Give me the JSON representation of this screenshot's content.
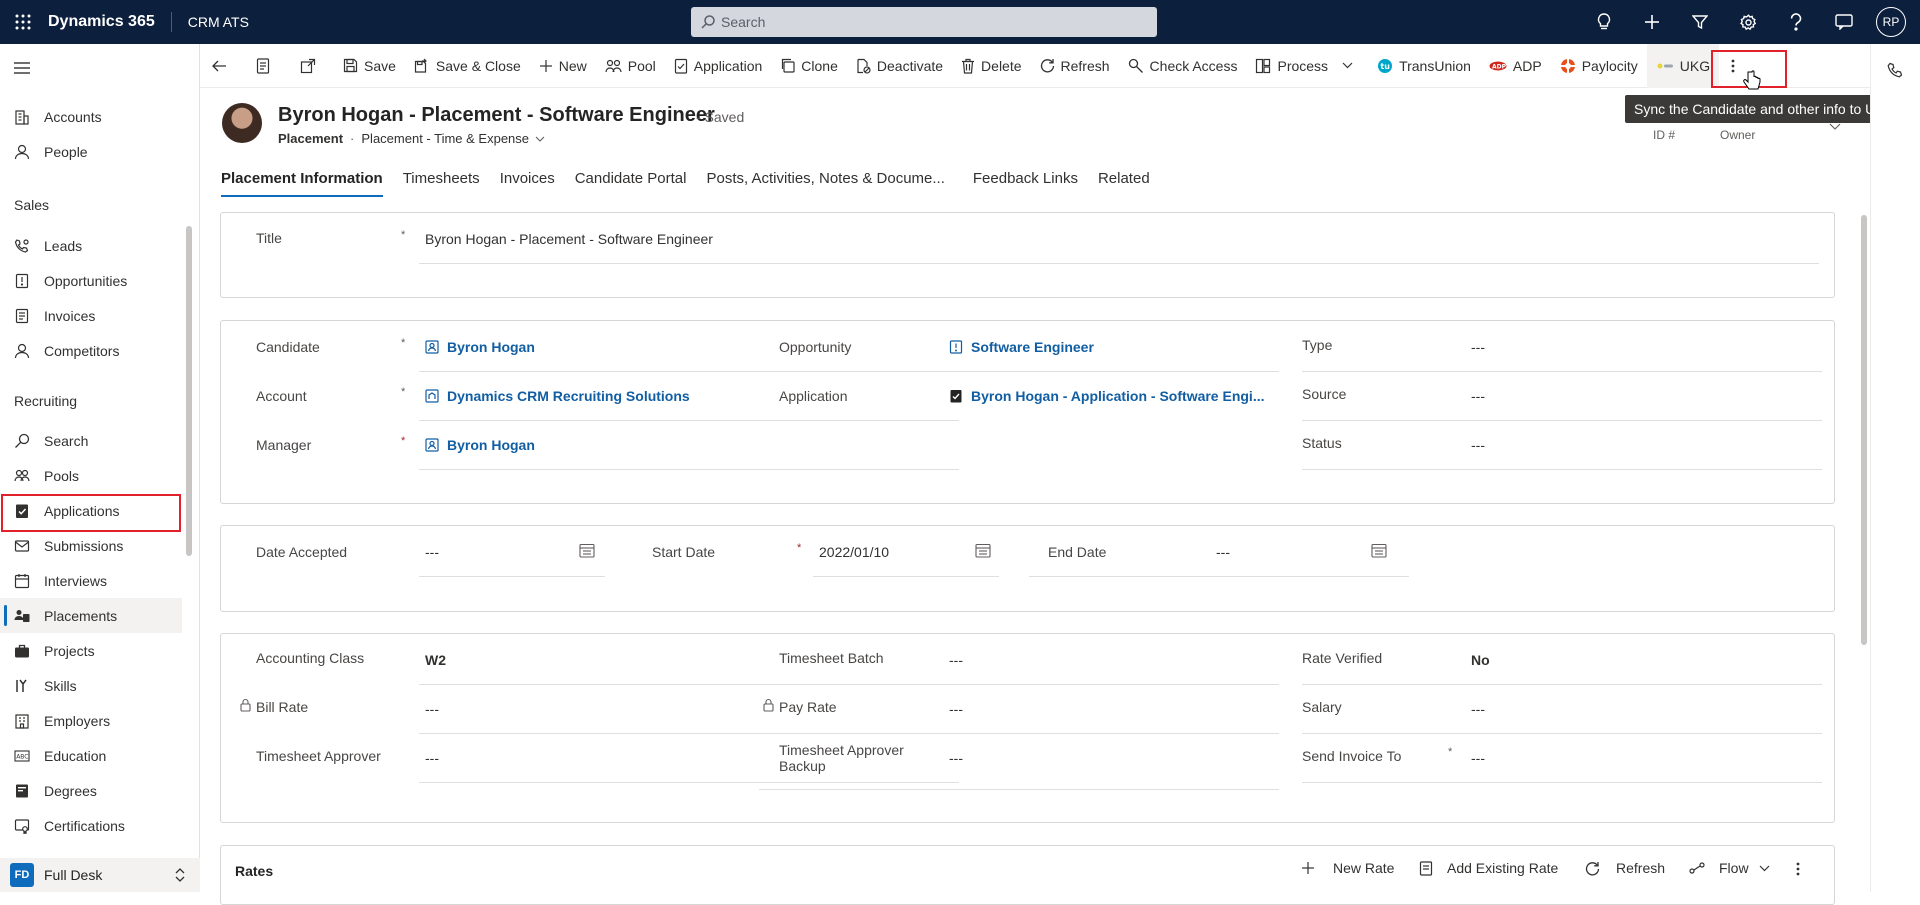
{
  "topbar": {
    "brand": "Dynamics 365",
    "app_name": "CRM ATS",
    "search_placeholder": "Search",
    "user_initials": "RP"
  },
  "sidebar": {
    "items_top": [
      {
        "label": "Accounts",
        "icon": "building-icon"
      },
      {
        "label": "People",
        "icon": "person-icon"
      }
    ],
    "section_sales": "Sales",
    "items_sales": [
      {
        "label": "Leads",
        "icon": "phone-person-icon"
      },
      {
        "label": "Opportunities",
        "icon": "document-alert-icon"
      },
      {
        "label": "Invoices",
        "icon": "invoice-icon"
      },
      {
        "label": "Competitors",
        "icon": "person-icon"
      }
    ],
    "section_recruiting": "Recruiting",
    "items_recruiting": [
      {
        "label": "Search",
        "icon": "search-icon"
      },
      {
        "label": "Pools",
        "icon": "people-group-icon"
      },
      {
        "label": "Applications",
        "icon": "clipboard-check-icon"
      },
      {
        "label": "Submissions",
        "icon": "submission-icon"
      },
      {
        "label": "Interviews",
        "icon": "calendar-icon"
      },
      {
        "label": "Placements",
        "icon": "placement-icon"
      },
      {
        "label": "Projects",
        "icon": "briefcase-icon"
      },
      {
        "label": "Skills",
        "icon": "skills-icon"
      },
      {
        "label": "Employers",
        "icon": "employer-icon"
      },
      {
        "label": "Education",
        "icon": "education-icon"
      },
      {
        "label": "Degrees",
        "icon": "degree-icon"
      },
      {
        "label": "Certifications",
        "icon": "certificate-icon"
      }
    ],
    "footer_badge": "FD",
    "footer_label": "Full Desk"
  },
  "commandbar": {
    "save": "Save",
    "save_close": "Save & Close",
    "new": "New",
    "pool": "Pool",
    "application": "Application",
    "clone": "Clone",
    "deactivate": "Deactivate",
    "delete": "Delete",
    "refresh": "Refresh",
    "check_access": "Check Access",
    "process": "Process",
    "transunion": "TransUnion",
    "adp": "ADP",
    "paylocity": "Paylocity",
    "ukg": "UKG",
    "ukg_tooltip": "Sync the Candidate and other info to UKG"
  },
  "record": {
    "title": "Byron Hogan - Placement - Software Engineer",
    "saved_status": "- Saved",
    "entity": "Placement",
    "form_name": "Placement - Time & Expense",
    "header_id_label": "ID #",
    "header_owner_label": "Owner"
  },
  "tabs": [
    "Placement Information",
    "Timesheets",
    "Invoices",
    "Candidate Portal",
    "Posts, Activities, Notes & Docume...",
    "Feedback Links",
    "Related"
  ],
  "section_title": {
    "title_label": "Title",
    "title_value": "Byron Hogan - Placement - Software Engineer"
  },
  "section_people": {
    "candidate_label": "Candidate",
    "candidate_value": "Byron Hogan",
    "account_label": "Account",
    "account_value": "Dynamics CRM Recruiting Solutions",
    "manager_label": "Manager",
    "manager_value": "Byron Hogan",
    "opportunity_label": "Opportunity",
    "opportunity_value": "Software Engineer",
    "application_label": "Application",
    "application_value": "Byron Hogan - Application - Software Engi...",
    "type_label": "Type",
    "type_value": "---",
    "source_label": "Source",
    "source_value": "---",
    "status_label": "Status",
    "status_value": "---"
  },
  "section_dates": {
    "date_accepted_label": "Date Accepted",
    "date_accepted_value": "---",
    "start_date_label": "Start Date",
    "start_date_value": "2022/01/10",
    "end_date_label": "End Date",
    "end_date_value": "---"
  },
  "section_rates": {
    "accounting_class_label": "Accounting Class",
    "accounting_class_value": "W2",
    "bill_rate_label": "Bill Rate",
    "bill_rate_value": "---",
    "timesheet_approver_label": "Timesheet Approver",
    "timesheet_approver_value": "---",
    "timesheet_batch_label": "Timesheet Batch",
    "timesheet_batch_value": "---",
    "pay_rate_label": "Pay Rate",
    "pay_rate_value": "---",
    "timesheet_approver_backup_label_1": "Timesheet Approver",
    "timesheet_approver_backup_label_2": "Backup",
    "timesheet_approver_backup_value": "---",
    "rate_verified_label": "Rate Verified",
    "rate_verified_value": "No",
    "salary_label": "Salary",
    "salary_value": "---",
    "send_invoice_to_label": "Send Invoice To",
    "send_invoice_to_value": "---"
  },
  "rates_grid": {
    "title": "Rates",
    "new_rate": "New Rate",
    "add_existing_rate": "Add Existing Rate",
    "refresh": "Refresh",
    "flow": "Flow"
  },
  "colors": {
    "topbar_bg": "#0c1f3d",
    "link": "#115ea3",
    "accent": "#0f6cbd",
    "highlight_box": "#e2202a"
  }
}
